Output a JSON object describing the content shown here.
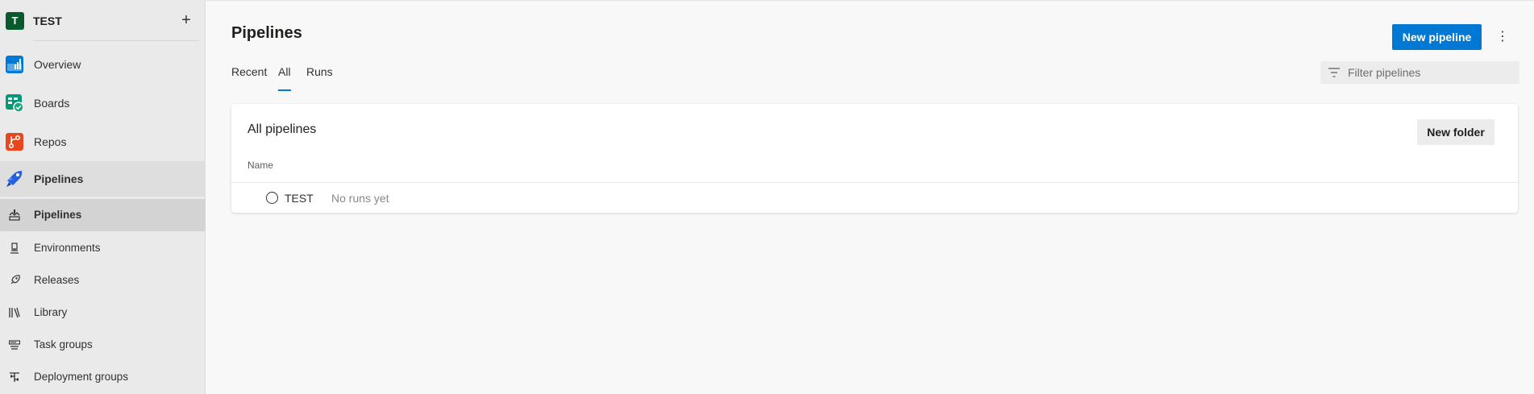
{
  "sidebar": {
    "project": {
      "initial": "T",
      "name": "TEST",
      "add_label": "+"
    },
    "areas": [
      {
        "label": "Overview",
        "icon": "overview-icon"
      },
      {
        "label": "Boards",
        "icon": "boards-icon"
      },
      {
        "label": "Repos",
        "icon": "repos-icon"
      },
      {
        "label": "Pipelines",
        "icon": "pipelines-icon"
      }
    ],
    "sub_items": [
      {
        "label": "Pipelines",
        "icon": "pipelines-sub-icon"
      },
      {
        "label": "Environments",
        "icon": "environments-icon"
      },
      {
        "label": "Releases",
        "icon": "releases-icon"
      },
      {
        "label": "Library",
        "icon": "library-icon"
      },
      {
        "label": "Task groups",
        "icon": "task-groups-icon"
      },
      {
        "label": "Deployment groups",
        "icon": "deployment-groups-icon"
      }
    ]
  },
  "header": {
    "title": "Pipelines",
    "new_pipeline_label": "New pipeline",
    "more_label": "⋮"
  },
  "tabs": [
    {
      "label": "Recent",
      "active": false
    },
    {
      "label": "All",
      "active": true
    },
    {
      "label": "Runs",
      "active": false
    }
  ],
  "filter": {
    "placeholder": "Filter pipelines"
  },
  "card": {
    "title": "All pipelines",
    "new_folder_label": "New folder",
    "column_header": "Name",
    "rows": [
      {
        "name": "TEST",
        "status": "No runs yet"
      }
    ]
  },
  "colors": {
    "accent": "#0078d4",
    "sidebar_bg": "#eaeaea",
    "selected_bg": "#d3d3d3",
    "project_avatar": "#0b5a2e"
  }
}
